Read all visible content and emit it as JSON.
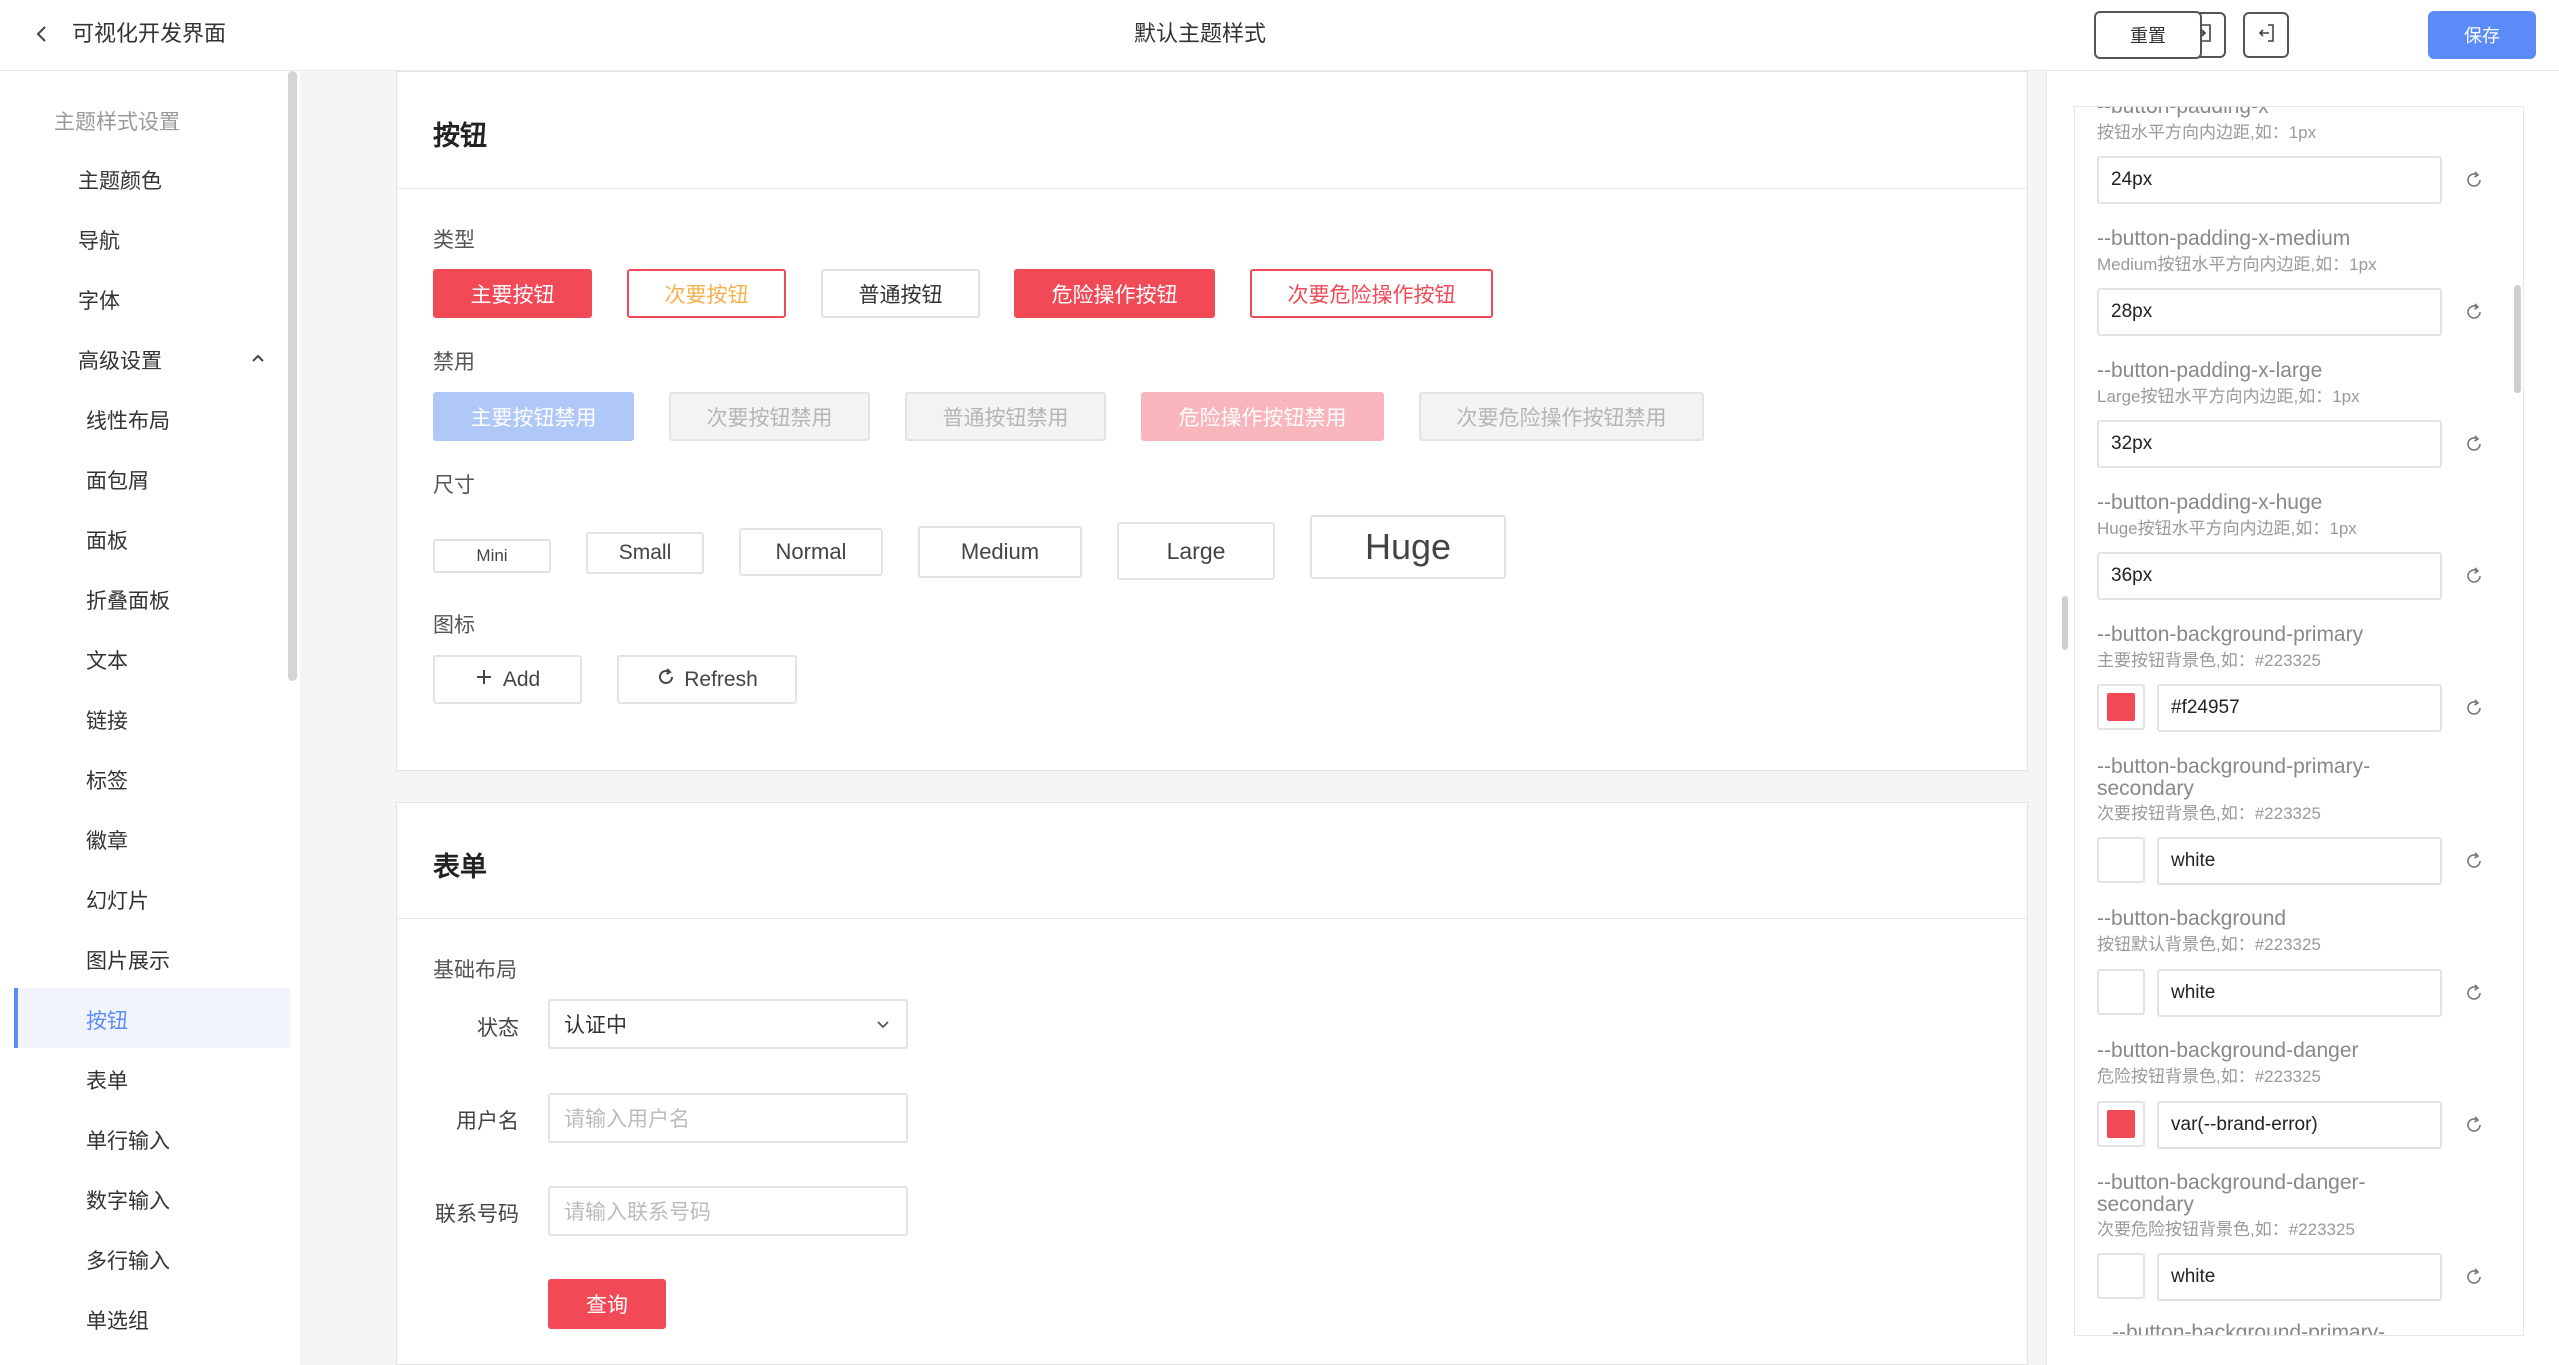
{
  "header": {
    "app_title": "可视化开发界面",
    "page_title": "默认主题样式",
    "import_icon": "login-icon",
    "export_icon": "logout-icon",
    "reset_label": "重置",
    "save_label": "保存",
    "accent_color": "#5b8bf7"
  },
  "sidebar": {
    "group_label": "主题样式设置",
    "items": [
      "主题颜色",
      "导航",
      "字体"
    ],
    "advanced_label": "高级设置",
    "sub_items": [
      "线性布局",
      "面包屑",
      "面板",
      "折叠面板",
      "文本",
      "链接",
      "标签",
      "徽章",
      "幻灯片",
      "图片展示",
      "按钮",
      "表单",
      "单行输入",
      "数字输入",
      "多行输入",
      "单选组"
    ],
    "active_item": "按钮"
  },
  "button_card": {
    "title": "按钮",
    "type_label": "类型",
    "type_buttons": [
      "主要按钮",
      "次要按钮",
      "普通按钮",
      "危险操作按钮",
      "次要危险操作按钮"
    ],
    "disabled_label": "禁用",
    "disabled_buttons": [
      "主要按钮禁用",
      "次要按钮禁用",
      "普通按钮禁用",
      "危险操作按钮禁用",
      "次要危险操作按钮禁用"
    ],
    "size_label": "尺寸",
    "size_buttons": [
      "Mini",
      "Small",
      "Normal",
      "Medium",
      "Large",
      "Huge"
    ],
    "icon_label": "图标",
    "icon_buttons": [
      {
        "label": "Add",
        "icon": "plus-icon"
      },
      {
        "label": "Refresh",
        "icon": "refresh-icon"
      }
    ]
  },
  "form_card": {
    "title": "表单",
    "layout_label": "基础布局",
    "status_label": "状态",
    "status_value": "认证中",
    "username_label": "用户名",
    "username_placeholder": "请输入用户名",
    "phone_label": "联系号码",
    "phone_placeholder": "请输入联系号码",
    "query_label": "查询"
  },
  "properties": {
    "top_partial_name": "--button-padding-x",
    "items": [
      {
        "desc": "按钮水平方向内边距,如：1px",
        "value": "24px"
      },
      {
        "name": "--button-padding-x-medium",
        "desc": "Medium按钮水平方向内边距,如：1px",
        "value": "28px"
      },
      {
        "name": "--button-padding-x-large",
        "desc": "Large按钮水平方向内边距,如：1px",
        "value": "32px"
      },
      {
        "name": "--button-padding-x-huge",
        "desc": "Huge按钮水平方向内边距,如：1px",
        "value": "36px"
      },
      {
        "name": "--button-background-primary",
        "desc": "主要按钮背景色,如：#223325",
        "value": "#f24957",
        "swatch": "#f24957"
      },
      {
        "name_line1": "--button-background-primary-",
        "name_line2": "secondary",
        "desc": "次要按钮背景色,如：#223325",
        "value": "white",
        "swatch": "#ffffff"
      },
      {
        "name": "--button-background",
        "desc": "按钮默认背景色,如：#223325",
        "value": "white",
        "swatch": "#ffffff"
      },
      {
        "name": "--button-background-danger",
        "desc": "危险按钮背景色,如：#223325",
        "value": "var(--brand-error)",
        "swatch": "#f24957"
      },
      {
        "name_line1": "--button-background-danger-",
        "name_line2": "secondary",
        "desc": "次要危险按钮背景色,如：#223325",
        "value": "white",
        "swatch": "#ffffff"
      }
    ],
    "bottom_partial_name": "--button-background-primary-"
  },
  "colors": {
    "primary": "#f24957",
    "secondary_text": "#f5b14d",
    "disabled_primary": "#afc8f8",
    "disabled_danger": "#f8b5bb"
  }
}
